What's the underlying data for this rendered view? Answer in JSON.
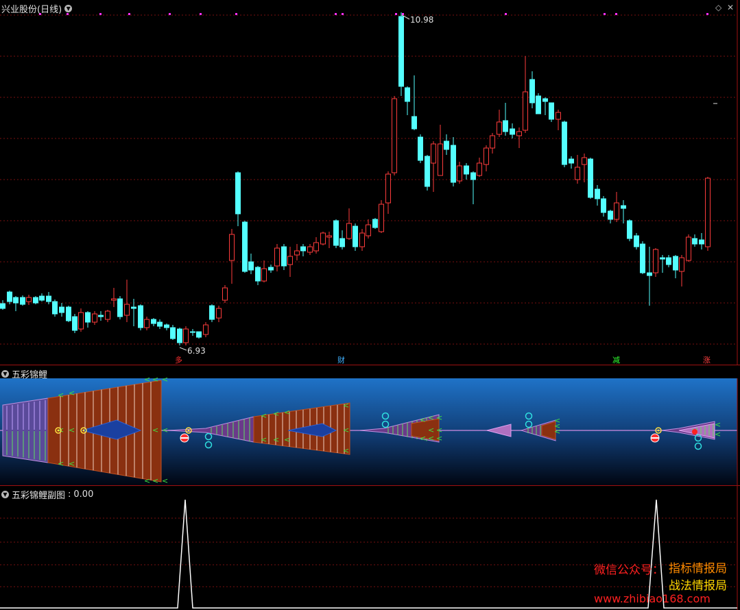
{
  "main_chart": {
    "title": "兴业股份(日线)",
    "high_label": "10.98",
    "low_label": "6.93",
    "signals": [
      {
        "text": "多",
        "color": "#ff3030"
      },
      {
        "text": "财",
        "color": "#40b0ff"
      },
      {
        "text": "减",
        "color": "#30ff30"
      },
      {
        "text": "涨",
        "color": "#ff4040"
      }
    ],
    "up_color": "#ff3c3c",
    "down_color": "#54ffff"
  },
  "indicator1": {
    "title": "五彩锦鲤"
  },
  "indicator2": {
    "title": "五彩锦鲤副图",
    "value": "0.00"
  },
  "watermark": {
    "line1_left": "微信公众号：",
    "line1_right": "指标情报局",
    "line2": "战法情报局",
    "url": "www.zhibiao168.com"
  }
}
